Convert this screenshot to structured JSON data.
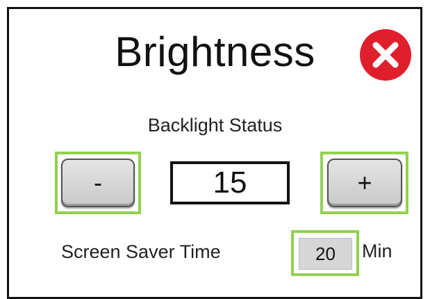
{
  "title": "Brightness",
  "close_button": {
    "icon": "close-icon",
    "color": "#e01f2d"
  },
  "backlight": {
    "label": "Backlight Status",
    "value": "15",
    "decrease_label": "-",
    "increase_label": "+"
  },
  "screen_saver": {
    "label": "Screen Saver Time",
    "value": "20",
    "unit": "Min"
  },
  "highlight_color": "#92d050"
}
